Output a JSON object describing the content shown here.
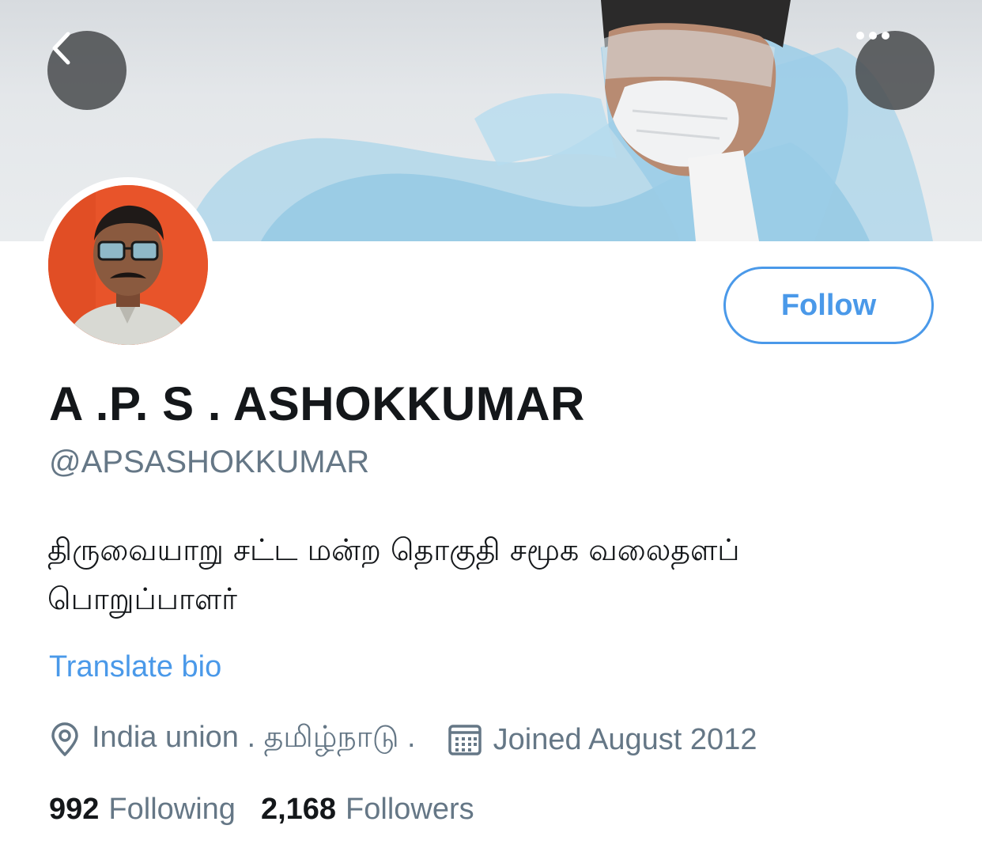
{
  "profile": {
    "display_name": "A .P. S . ASHOKKUMAR",
    "handle": "@APSASHOKKUMAR",
    "bio_line1": "திருவையாறு சட்ட மன்ற தொகுதி சமூக வலைதளப்",
    "bio_line2": "பொறுப்பாளர்",
    "translate_label": "Translate bio",
    "location": "India union . தமிழ்நாடு .",
    "joined": "Joined August 2012"
  },
  "actions": {
    "follow_label": "Follow"
  },
  "stats": {
    "following_count": "992",
    "following_label": "Following",
    "followers_count": "2,168",
    "followers_label": "Followers"
  },
  "icons": {
    "back": "chevron-left-icon",
    "more": "more-dots-icon",
    "location": "location-pin-icon",
    "calendar": "calendar-icon"
  },
  "colors": {
    "accent": "#4a99e9",
    "secondary_text": "#657786",
    "primary_text": "#14171a",
    "avatar_bg": "#e8542a"
  }
}
